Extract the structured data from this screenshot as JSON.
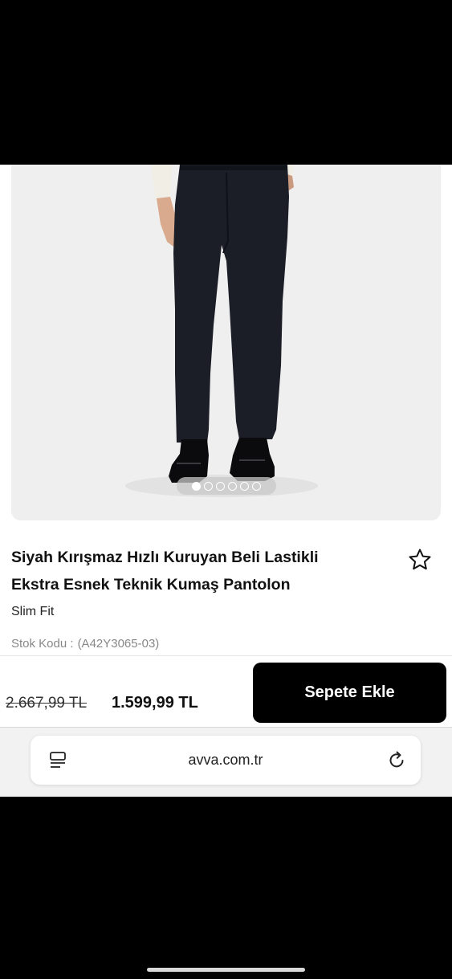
{
  "product": {
    "title_line1": "Siyah Kırışmaz Hızlı Kuruyan Beli Lastikli",
    "title_line2": "Ekstra Esnek Teknik Kumaş Pantolon",
    "fit": "Slim Fit",
    "sku_label": "Stok Kodu :",
    "sku_value": "(A42Y3065-03)"
  },
  "gallery": {
    "image_count": 6,
    "active_index": 0
  },
  "pricing": {
    "old_price": "2.667,99 TL",
    "new_price": "1.599,99 TL",
    "cta_label": "Sepete Ekle"
  },
  "browser": {
    "url": "avva.com.tr"
  },
  "icons": {
    "favorite": "star-icon",
    "reader": "reader-mode-icon",
    "reload": "reload-icon"
  },
  "colors": {
    "cta_background": "#000000",
    "cta_text": "#ffffff"
  }
}
